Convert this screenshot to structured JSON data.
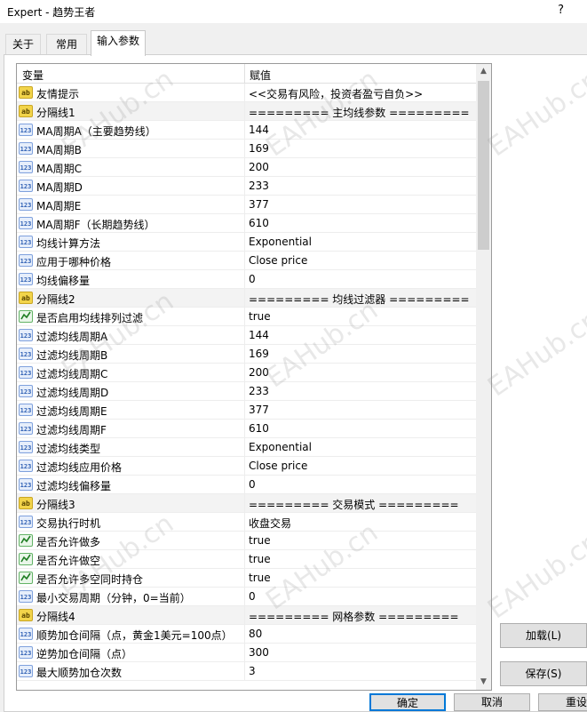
{
  "window": {
    "title": "Expert - 趋势王者",
    "help": "?"
  },
  "tabs": [
    {
      "label": "关于"
    },
    {
      "label": "常用"
    },
    {
      "label": "输入参数"
    }
  ],
  "table": {
    "col_variable": "变量",
    "col_value": "赋值",
    "rows": [
      {
        "type": "ab",
        "name": "友情提示",
        "value": "<<交易有风险，投资者盈亏自负>>"
      },
      {
        "type": "ab",
        "name": "分隔线1",
        "value": "========= 主均线参数 ========="
      },
      {
        "type": "num",
        "name": "MA周期A（主要趋势线）",
        "value": "144"
      },
      {
        "type": "num",
        "name": "MA周期B",
        "value": "169"
      },
      {
        "type": "num",
        "name": "MA周期C",
        "value": "200"
      },
      {
        "type": "num",
        "name": "MA周期D",
        "value": "233"
      },
      {
        "type": "num",
        "name": "MA周期E",
        "value": "377"
      },
      {
        "type": "num",
        "name": "MA周期F（长期趋势线）",
        "value": "610"
      },
      {
        "type": "num",
        "name": "均线计算方法",
        "value": "Exponential"
      },
      {
        "type": "num",
        "name": "应用于哪种价格",
        "value": "Close price"
      },
      {
        "type": "num",
        "name": "均线偏移量",
        "value": "0"
      },
      {
        "type": "ab",
        "name": "分隔线2",
        "value": "========= 均线过滤器 ========="
      },
      {
        "type": "bool",
        "name": "是否启用均线排列过滤",
        "value": "true"
      },
      {
        "type": "num",
        "name": "过滤均线周期A",
        "value": "144"
      },
      {
        "type": "num",
        "name": "过滤均线周期B",
        "value": "169"
      },
      {
        "type": "num",
        "name": "过滤均线周期C",
        "value": "200"
      },
      {
        "type": "num",
        "name": "过滤均线周期D",
        "value": "233"
      },
      {
        "type": "num",
        "name": "过滤均线周期E",
        "value": "377"
      },
      {
        "type": "num",
        "name": "过滤均线周期F",
        "value": "610"
      },
      {
        "type": "num",
        "name": "过滤均线类型",
        "value": "Exponential"
      },
      {
        "type": "num",
        "name": "过滤均线应用价格",
        "value": "Close price"
      },
      {
        "type": "num",
        "name": "过滤均线偏移量",
        "value": "0"
      },
      {
        "type": "ab",
        "name": "分隔线3",
        "value": "========= 交易模式 ========="
      },
      {
        "type": "num",
        "name": "交易执行时机",
        "value": "收盘交易"
      },
      {
        "type": "bool",
        "name": "是否允许做多",
        "value": "true"
      },
      {
        "type": "bool",
        "name": "是否允许做空",
        "value": "true"
      },
      {
        "type": "bool",
        "name": "是否允许多空同时持仓",
        "value": "true"
      },
      {
        "type": "num",
        "name": "最小交易周期（分钟，0=当前）",
        "value": "0"
      },
      {
        "type": "ab",
        "name": "分隔线4",
        "value": "========= 网格参数 ========="
      },
      {
        "type": "num",
        "name": "顺势加仓间隔（点，黄金1美元=100点）",
        "value": "80"
      },
      {
        "type": "num",
        "name": "逆势加仓间隔（点）",
        "value": "300"
      },
      {
        "type": "num",
        "name": "最大顺势加仓次数",
        "value": "3"
      }
    ]
  },
  "icons": {
    "ab": "ab",
    "num": "123",
    "bool": "bool-icon"
  },
  "buttons": {
    "load": "加载(L)",
    "save": "保存(S)",
    "ok": "确定",
    "cancel": "取消",
    "reset": "重设"
  },
  "watermark": "EAHub.cn"
}
